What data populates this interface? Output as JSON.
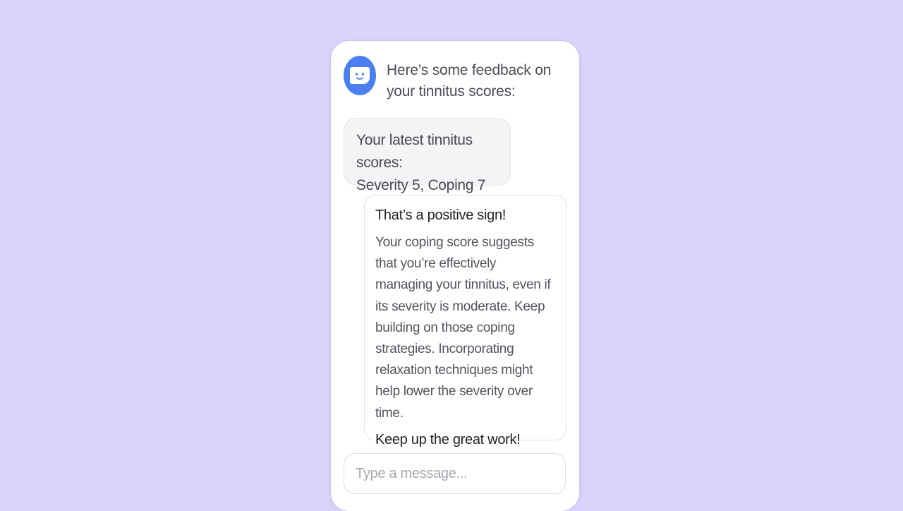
{
  "header": {
    "message": "Here’s some feedback on your tinnitus scores:",
    "avatar_icon": "chat-bot-face-icon",
    "avatar_color": "#4b7ff0"
  },
  "scores_bubble": {
    "line1": "Your latest tinnitus scores:",
    "line2": "Severity 5, Coping 7"
  },
  "feedback_bubble": {
    "title": "That’s a positive sign!",
    "body": "Your coping score suggests that you’re effectively managing your tinnitus, even if its severity is moderate. Keep building on those coping strategies. Incorporating relaxation techniques might help lower the severity over time.",
    "closing": "Keep up the great work!"
  },
  "composer": {
    "placeholder": "Type a message...",
    "value": ""
  },
  "colors": {
    "background": "#dcd3fd",
    "card": "#ffffff",
    "accent": "#4b7ff0"
  }
}
